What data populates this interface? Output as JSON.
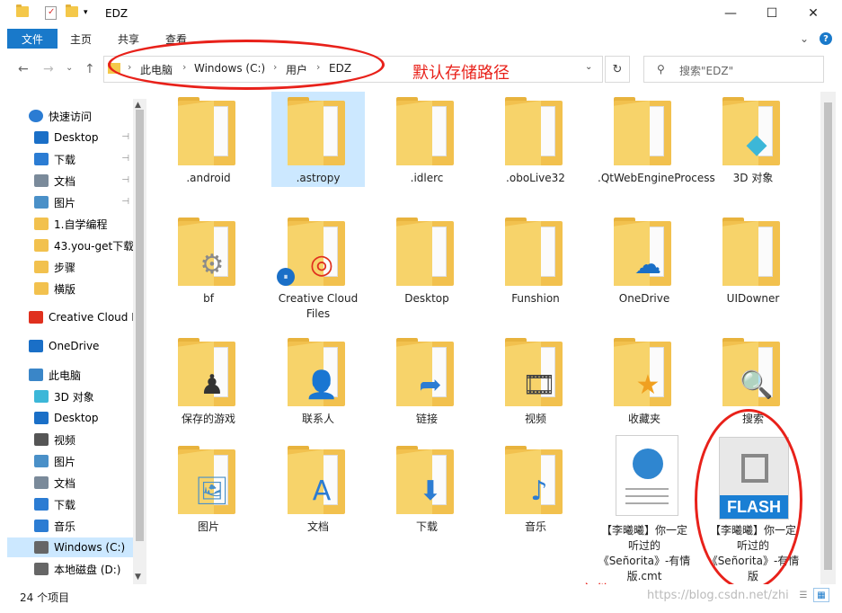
{
  "window": {
    "title": "EDZ",
    "minimize_glyph": "—",
    "maximize_glyph": "☐",
    "close_glyph": "✕"
  },
  "ribbon": {
    "tab_file": "文件",
    "tab_home": "主页",
    "tab_share": "共享",
    "tab_view": "查看",
    "expand_glyph": "⌄",
    "help_glyph": "?"
  },
  "nav": {
    "back_glyph": "←",
    "forward_glyph": "→",
    "dropdown_glyph": "⌄",
    "up_glyph": "↑",
    "breadcrumb": [
      "此电脑",
      "Windows (C:)",
      "用户",
      "EDZ"
    ],
    "crumb_sep": "›",
    "addr_dropdown_glyph": "⌄",
    "refresh_glyph": "↻",
    "search_placeholder": "搜索\"EDZ\"",
    "search_glyph": "⚲"
  },
  "annotations": {
    "path_label": "默认存储路径",
    "file_label": "文件",
    "color": "#e8211a"
  },
  "sidebar": {
    "items": [
      {
        "label": "快速访问",
        "icon": "star-icon",
        "pinned": false
      },
      {
        "label": "Desktop",
        "icon": "desktop-icon",
        "pinned": true
      },
      {
        "label": "下载",
        "icon": "download-icon",
        "pinned": true
      },
      {
        "label": "文档",
        "icon": "document-icon",
        "pinned": true
      },
      {
        "label": "图片",
        "icon": "pictures-icon",
        "pinned": true
      },
      {
        "label": "1.自学编程",
        "icon": "folder-icon",
        "pinned": false
      },
      {
        "label": "43.you-get下载",
        "icon": "folder-icon",
        "pinned": false
      },
      {
        "label": "步骤",
        "icon": "folder-icon",
        "pinned": false
      },
      {
        "label": "横版",
        "icon": "folder-icon",
        "pinned": false
      },
      {
        "label": "Creative Cloud F",
        "icon": "creative-cloud-icon",
        "pinned": false
      },
      {
        "label": "OneDrive",
        "icon": "onedrive-icon",
        "pinned": false
      },
      {
        "label": "此电脑",
        "icon": "computer-icon",
        "pinned": false
      },
      {
        "label": "3D 对象",
        "icon": "cube-icon",
        "pinned": false
      },
      {
        "label": "Desktop",
        "icon": "desktop-icon",
        "pinned": false
      },
      {
        "label": "视频",
        "icon": "video-icon",
        "pinned": false
      },
      {
        "label": "图片",
        "icon": "pictures-icon",
        "pinned": false
      },
      {
        "label": "文档",
        "icon": "document-icon",
        "pinned": false
      },
      {
        "label": "下载",
        "icon": "download-icon",
        "pinned": false
      },
      {
        "label": "音乐",
        "icon": "music-icon",
        "pinned": false
      },
      {
        "label": "Windows (C:)",
        "icon": "drive-icon",
        "pinned": false
      },
      {
        "label": "本地磁盘 (D:)",
        "icon": "drive-icon",
        "pinned": false
      }
    ],
    "pin_glyph": "⊣"
  },
  "files": [
    {
      "label": ".android",
      "type": "folder"
    },
    {
      "label": ".astropy",
      "type": "folder"
    },
    {
      "label": ".idlerc",
      "type": "folder"
    },
    {
      "label": ".oboLive32",
      "type": "folder"
    },
    {
      "label": ".QtWebEngineProcess",
      "type": "folder"
    },
    {
      "label": "3D 对象",
      "type": "folder"
    },
    {
      "label": "bf",
      "type": "folder"
    },
    {
      "label": "Creative Cloud Files",
      "type": "folder"
    },
    {
      "label": "Desktop",
      "type": "folder"
    },
    {
      "label": "Funshion",
      "type": "folder"
    },
    {
      "label": "OneDrive",
      "type": "folder"
    },
    {
      "label": "UIDowner",
      "type": "folder"
    },
    {
      "label": "保存的游戏",
      "type": "folder"
    },
    {
      "label": "联系人",
      "type": "folder"
    },
    {
      "label": "链接",
      "type": "folder"
    },
    {
      "label": "视频",
      "type": "folder"
    },
    {
      "label": "收藏夹",
      "type": "folder"
    },
    {
      "label": "搜索",
      "type": "folder"
    },
    {
      "label": "图片",
      "type": "folder"
    },
    {
      "label": "文档",
      "type": "folder"
    },
    {
      "label": "下载",
      "type": "folder"
    },
    {
      "label": "音乐",
      "type": "folder"
    },
    {
      "label": "【李曦曦】你一定听过的《Señorita》-有情版.cmt",
      "type": "file"
    },
    {
      "label": "【李曦曦】你一定听过的《Señorita》-有情版",
      "type": "flash"
    }
  ],
  "flash_badge": "FLASH",
  "status": {
    "item_count": "24 个项目",
    "watermark": "https://blog.csdn.net/zhi"
  },
  "emblems": {
    "chess": "♟",
    "contact": "👤",
    "link": "➦",
    "film": "🎞",
    "star": "★",
    "search": "🔍",
    "picture": "🖼",
    "doc": "A",
    "download": "⬇",
    "music": "♪",
    "gear": "⚙",
    "cloud": "☁",
    "cube": "◆",
    "pause": "⏸",
    "creative": "◎",
    "globe": "🌐"
  }
}
